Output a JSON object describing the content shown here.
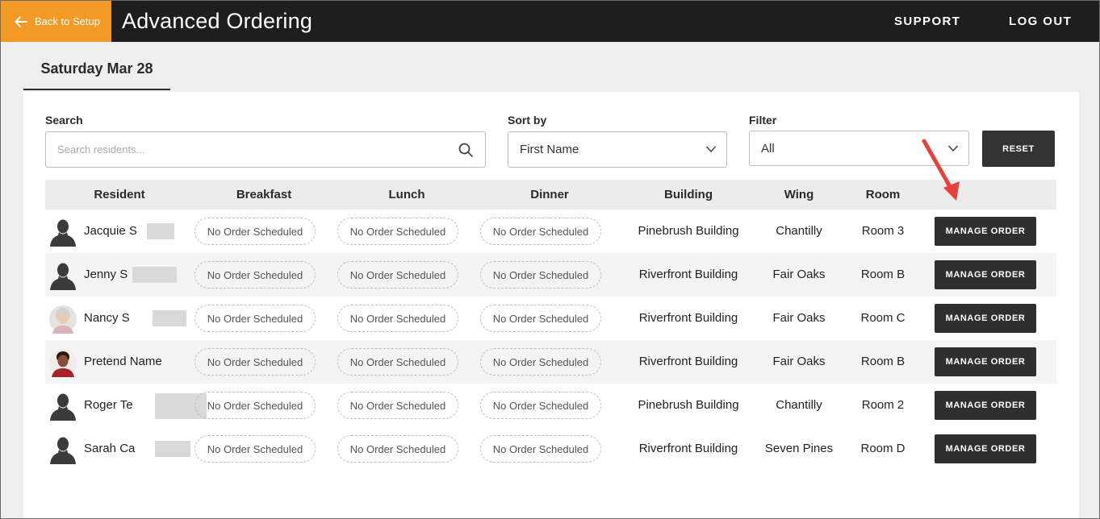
{
  "header": {
    "back_label": "Back to Setup",
    "title": "Advanced Ordering",
    "support_label": "SUPPORT",
    "logout_label": "LOG OUT",
    "accent_color": "#f39a26",
    "bar_color": "#1e1e1e"
  },
  "date_tab": {
    "label": "Saturday Mar 28"
  },
  "controls": {
    "search_label": "Search",
    "search_placeholder": "Search residents...",
    "sort_label": "Sort by",
    "sort_value": "First Name",
    "filter_label": "Filter",
    "filter_value": "All",
    "reset_label": "RESET"
  },
  "table": {
    "columns": [
      "Resident",
      "Breakfast",
      "Lunch",
      "Dinner",
      "Building",
      "Wing",
      "Room"
    ],
    "rows": [
      {
        "name": "Jacquie S",
        "avatar": "silhouette-icon",
        "breakfast": "No Order Scheduled",
        "lunch": "No Order Scheduled",
        "dinner": "No Order Scheduled",
        "building": "Pinebrush Building",
        "wing": "Chantilly",
        "room": "Room 3",
        "action": "MANAGE ORDER"
      },
      {
        "name": "Jenny S",
        "avatar": "silhouette-icon",
        "breakfast": "No Order Scheduled",
        "lunch": "No Order Scheduled",
        "dinner": "No Order Scheduled",
        "building": "Riverfront Building",
        "wing": "Fair Oaks",
        "room": "Room B",
        "action": "MANAGE ORDER"
      },
      {
        "name": "Nancy S",
        "avatar": "photo-avatar",
        "breakfast": "No Order Scheduled",
        "lunch": "No Order Scheduled",
        "dinner": "No Order Scheduled",
        "building": "Riverfront Building",
        "wing": "Fair Oaks",
        "room": "Room C",
        "action": "MANAGE ORDER"
      },
      {
        "name": "Pretend Name",
        "avatar": "photo-avatar",
        "breakfast": "No Order Scheduled",
        "lunch": "No Order Scheduled",
        "dinner": "No Order Scheduled",
        "building": "Riverfront Building",
        "wing": "Fair Oaks",
        "room": "Room B",
        "action": "MANAGE ORDER"
      },
      {
        "name": "Roger Te",
        "avatar": "silhouette-icon",
        "breakfast": "No Order Scheduled",
        "lunch": "No Order Scheduled",
        "dinner": "No Order Scheduled",
        "building": "Pinebrush Building",
        "wing": "Chantilly",
        "room": "Room 2",
        "action": "MANAGE ORDER"
      },
      {
        "name": "Sarah Ca",
        "avatar": "silhouette-icon",
        "breakfast": "No Order Scheduled",
        "lunch": "No Order Scheduled",
        "dinner": "No Order Scheduled",
        "building": "Riverfront Building",
        "wing": "Seven Pines",
        "room": "Room D",
        "action": "MANAGE ORDER"
      }
    ]
  },
  "annotation": {
    "arrow_color": "#e8403b"
  }
}
